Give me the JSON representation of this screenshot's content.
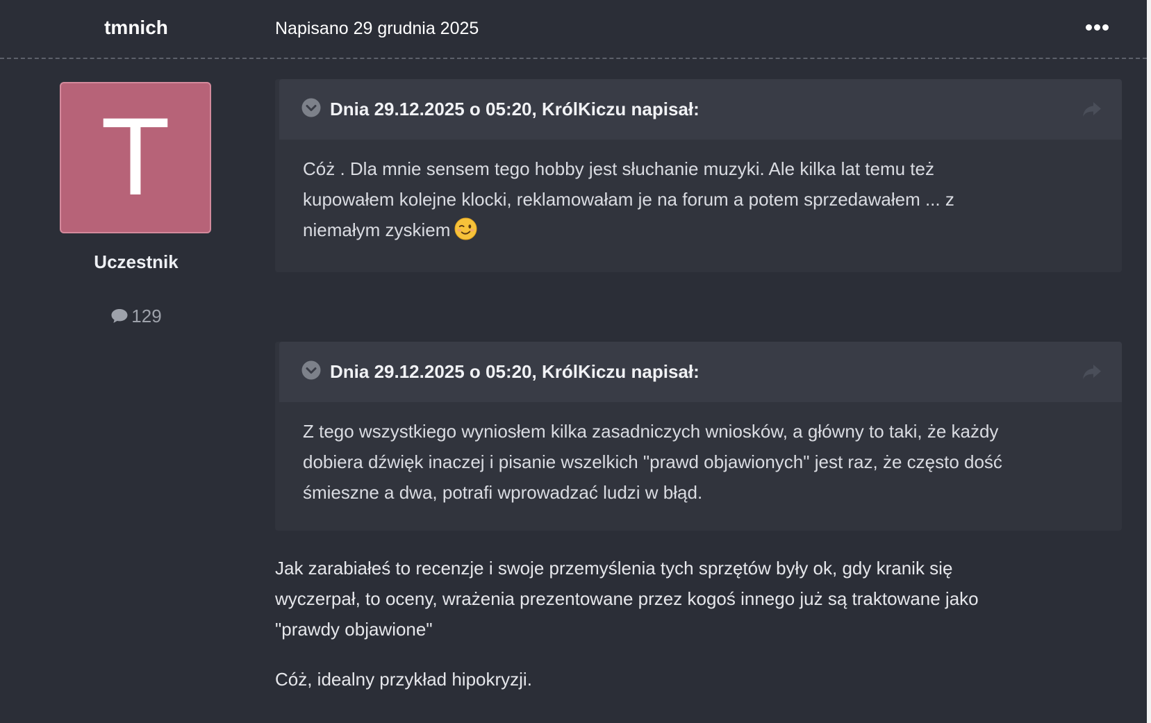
{
  "post": {
    "author": "tmnich",
    "posted_label": "Napisano 29 grudnia 2025",
    "menu_icon": "ellipsis-icon"
  },
  "user": {
    "avatar_letter": "T",
    "avatar_color": "#b76378",
    "rank": "Uczestnik",
    "post_count": "129"
  },
  "quotes": [
    {
      "citation": "Dnia 29.12.2025 o 05:20, KrólKiczu napisał:",
      "line1": "Cóż . Dla mnie sensem tego hobby jest słuchanie muzyki. Ale kilka lat temu też",
      "line2": "kupowałem kolejne klocki, reklamowałam je na forum a potem sprzedawałem ... z",
      "line3": "niemałym zyskiem",
      "emoji": "winking-face-emoji"
    },
    {
      "citation": "Dnia 29.12.2025 o 05:20, KrólKiczu napisał:",
      "line1": "Z tego wszystkiego wyniosłem kilka zasadniczych wniosków, a główny to taki, że każdy",
      "line2": "dobiera dźwięk inaczej i pisanie wszelkich \"prawd objawionych\" jest raz, że często dość",
      "line3": "śmieszne a dwa, potrafi wprowadzać ludzi w błąd."
    }
  ],
  "reply": {
    "line1": "Jak zarabiałeś to recenzje i swoje przemyślenia  tych sprzętów były ok, gdy kranik się",
    "line2": "wyczerpał, to oceny, wrażenia prezentowane przez kogoś innego już są traktowane jako",
    "line3": "\"prawdy objawione\"",
    "closing": "Cóż, idealny przykład hipokryzji."
  },
  "colors": {
    "background": "#2b2e37",
    "quote_background": "#31343d",
    "quote_header": "#393c46",
    "text": "#dfe1e6"
  }
}
